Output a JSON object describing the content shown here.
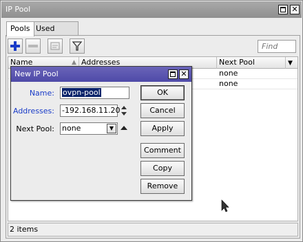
{
  "window": {
    "title": "IP Pool"
  },
  "tabs": [
    {
      "label": "Pools"
    },
    {
      "label": "Used Addresses"
    }
  ],
  "toolbar": {
    "find_placeholder": "Find"
  },
  "table": {
    "columns": [
      {
        "label": "Name"
      },
      {
        "label": "Addresses"
      },
      {
        "label": "Next Pool"
      }
    ],
    "rows": [
      {
        "name": "",
        "addresses": "",
        "next_pool": "none"
      },
      {
        "name": "",
        "addresses": "",
        "next_pool": "none"
      }
    ]
  },
  "status": {
    "items": "2 items"
  },
  "dialog": {
    "title": "New IP Pool",
    "name_label": "Name:",
    "name_value": "ovpn-pool",
    "addresses_label": "Addresses:",
    "addresses_value": "-192.168.11.20",
    "next_pool_label": "Next Pool:",
    "next_pool_value": "none",
    "buttons": {
      "ok": "OK",
      "cancel": "Cancel",
      "apply": "Apply",
      "comment": "Comment",
      "copy": "Copy",
      "remove": "Remove"
    }
  },
  "colors": {
    "dialog_title": "#5550b0",
    "field_label_active": "#1a3cc8",
    "add_icon": "#1a3cc8"
  },
  "icons": [
    "maximize-icon",
    "close-icon",
    "add-icon",
    "remove-icon",
    "comment-icon",
    "filter-icon",
    "sort-icon",
    "dropdown-icon",
    "updown-icon",
    "up-arrow-icon",
    "cursor-icon"
  ]
}
